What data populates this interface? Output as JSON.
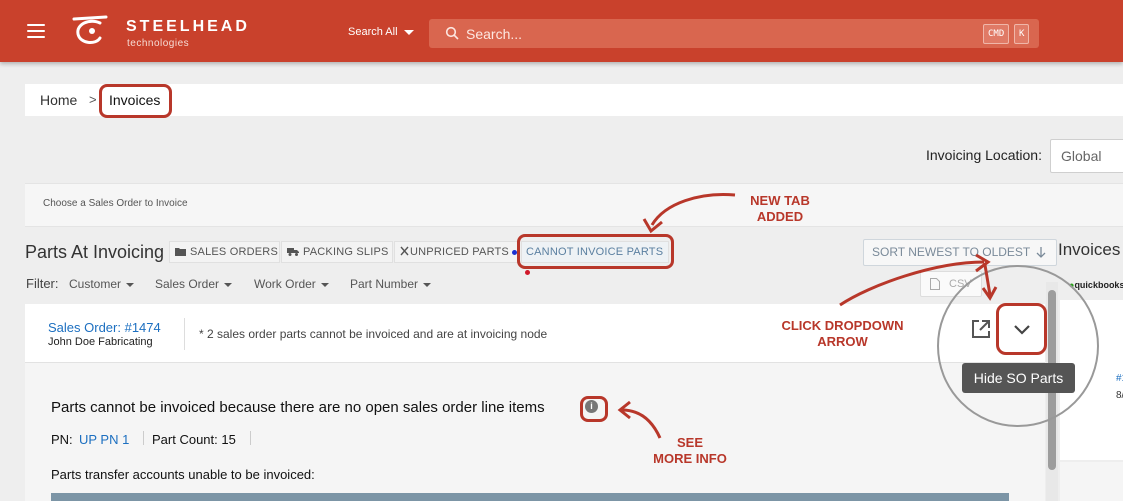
{
  "header": {
    "brand": "STEELHEAD",
    "brand_sub": "technologies",
    "search_scope": "Search All",
    "search_placeholder": "Search...",
    "shortcut_keys": [
      "CMD",
      "K"
    ],
    "colors": {
      "bar": "#c9412c",
      "annotation": "#b8372a",
      "link": "#1c6fc0"
    }
  },
  "breadcrumb": {
    "home": "Home",
    "separator": ">",
    "current": "Invoices"
  },
  "invoicing_location": {
    "label": "Invoicing Location:",
    "value": "Global"
  },
  "choose_text": "Choose a Sales Order to Invoice",
  "parts": {
    "title": "Parts At Invoicing",
    "tabs": [
      {
        "label": "SALES ORDERS",
        "icon": "folder-icon"
      },
      {
        "label": "PACKING SLIPS",
        "icon": "truck-icon"
      },
      {
        "label": "UNPRICED PARTS",
        "icon": "scissors-icon",
        "dot_color": "#1a2fd0"
      },
      {
        "label": "CANNOT INVOICE PARTS",
        "dot_color": "#d0182a"
      }
    ],
    "sort_label": "SORT NEWEST TO OLDEST",
    "csv_label": "CSV",
    "filter_label": "Filter:",
    "filters": [
      "Customer",
      "Sales Order",
      "Work Order",
      "Part Number"
    ]
  },
  "invoices": {
    "title": "Invoices",
    "quickbooks": "quickbooks",
    "row_number": "#1",
    "row_date": "8/"
  },
  "order": {
    "link": "Sales Order: #1474",
    "customer": "John Doe Fabricating",
    "note": "* 2 sales order parts cannot be invoiced and are at invoicing node",
    "tooltip": "Hide SO Parts"
  },
  "detail": {
    "cannot_message": "Parts cannot be invoiced because there are no open sales order line items",
    "pn_label": "PN:",
    "pn_value": "UP PN 1",
    "part_count_label": "Part Count:",
    "part_count": "15",
    "transfer_text": "Parts transfer accounts unable to be invoiced:"
  },
  "annotations": {
    "new_tab": [
      "NEW TAB",
      "ADDED"
    ],
    "click_dropdown": [
      "CLICK DROPDOWN",
      "ARROW"
    ],
    "see_more": [
      "SEE",
      "MORE INFO"
    ]
  }
}
